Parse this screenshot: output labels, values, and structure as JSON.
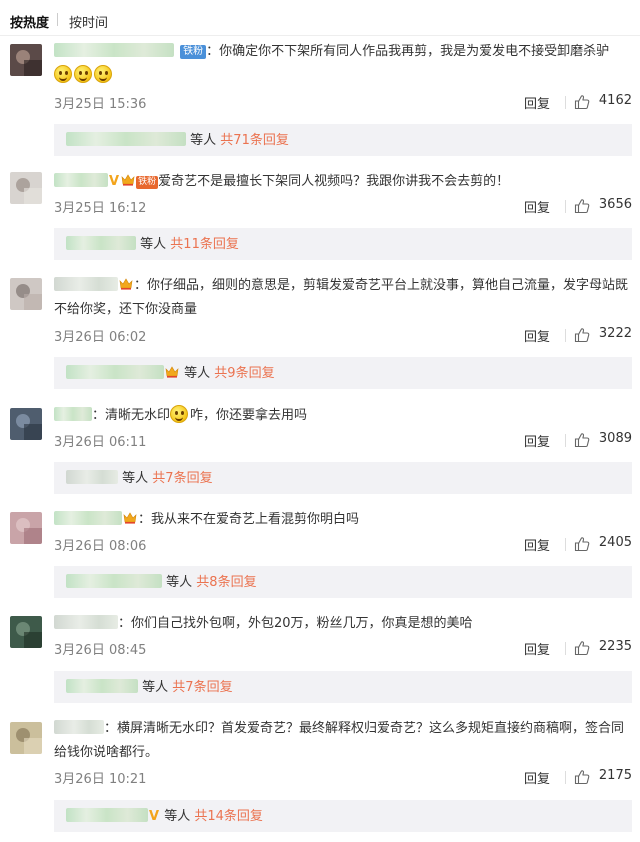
{
  "tabs": [
    {
      "label": "按热度",
      "active": true
    },
    {
      "label": "按时间",
      "active": false
    }
  ],
  "reply_label": "回复",
  "comments": [
    {
      "badge": "铁粉",
      "text": "：你确定你不下架所有同人作品我再剪，我是为爱发电不接受卸磨杀驴",
      "time": "3月25日 15:36",
      "likes": "4162",
      "sub_who": "等人",
      "sub_count": "共71条回复"
    },
    {
      "badge": "铁粉",
      "text": "爱奇艺不是最擅长下架同人视频吗？我跟你讲我不会去剪的！",
      "time": "3月25日 16:12",
      "likes": "3656",
      "sub_who": "等人",
      "sub_count": "共11条回复"
    },
    {
      "text": "：你仔细品，细则的意思是，剪辑发爱奇艺平台上就没事，算他自己流量，发字母站既不给你奖，还下你没商量",
      "time": "3月26日 06:02",
      "likes": "3222",
      "sub_who": "等人",
      "sub_count": "共9条回复"
    },
    {
      "text_a": "：清晰无水印",
      "text_b": "咋，你还要拿去用吗",
      "time": "3月26日 06:11",
      "likes": "3089",
      "sub_who": "等人",
      "sub_count": "共7条回复"
    },
    {
      "text": "：我从来不在爱奇艺上看混剪你明白吗",
      "time": "3月26日 08:06",
      "likes": "2405",
      "sub_who": "等人",
      "sub_count": "共8条回复"
    },
    {
      "text": "：你们自己找外包啊，外包20万，粉丝几万，你真是想的美哈",
      "time": "3月26日 08:45",
      "likes": "2235",
      "sub_who": "等人",
      "sub_count": "共7条回复"
    },
    {
      "text": "：横屏清晰无水印？首发爱奇艺？最终解释权归爱奇艺？这么多规矩直接约商稿啊，签合同给钱你说啥都行。",
      "time": "3月26日 10:21",
      "likes": "2175",
      "sub_who": "等人",
      "sub_count": "共14条回复"
    }
  ],
  "colors": {
    "accent_orange": "#eb7350",
    "fan_badge_blue": "#4a90d9",
    "sub_box_bg": "#f2f2f5"
  }
}
